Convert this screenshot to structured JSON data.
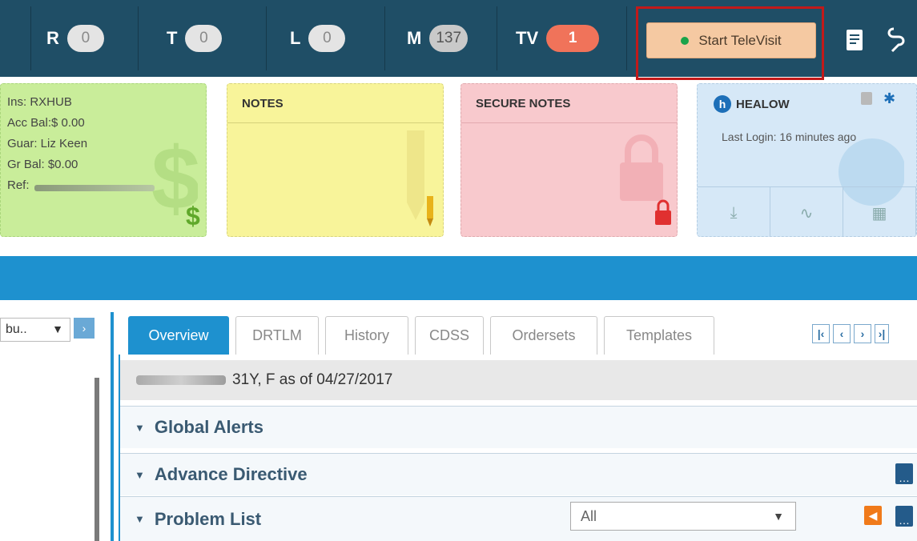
{
  "topbar": {
    "counters": [
      {
        "label": "R",
        "value": "0"
      },
      {
        "label": "T",
        "value": "0"
      },
      {
        "label": "L",
        "value": "0"
      },
      {
        "label": "M",
        "value": "137"
      },
      {
        "label": "TV",
        "value": "1"
      }
    ],
    "televisit_label": "Start TeleVisit",
    "icons": [
      "document-icon",
      "link-icon"
    ]
  },
  "financial": {
    "lines": [
      "Ins: RXHUB",
      "Acc Bal:$ 0.00",
      "Guar: Liz Keen",
      "Gr Bal: $0.00",
      "Ref:"
    ]
  },
  "notes": {
    "title": "NOTES"
  },
  "secure_notes": {
    "title": "SECURE NOTES"
  },
  "healow": {
    "title": "HEALOW",
    "last_login": "Last Login: 16 minutes ago"
  },
  "left_panel": {
    "select_value": "bu.."
  },
  "tabs": [
    {
      "label": "Overview",
      "active": true
    },
    {
      "label": "DRTLM"
    },
    {
      "label": "History"
    },
    {
      "label": "CDSS"
    },
    {
      "label": "Ordersets"
    },
    {
      "label": "Templates"
    }
  ],
  "patient": {
    "summary": "31Y, F as of 04/27/2017"
  },
  "sections": [
    {
      "label": "Global Alerts"
    },
    {
      "label": "Advance Directive"
    },
    {
      "label": "Problem List"
    }
  ],
  "problem_list_filter": "All",
  "colors": {
    "topbar": "#1f4e66",
    "accent": "#1e91cf",
    "televisit_bg": "#f5c9a2",
    "highlight_border": "#c21a1a"
  }
}
